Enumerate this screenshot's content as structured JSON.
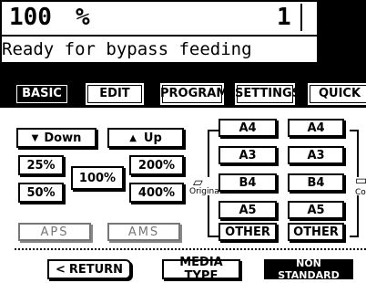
{
  "status": {
    "zoom_value": "100",
    "zoom_unit": "%",
    "copies": "1",
    "message": "Ready for bypass feeding"
  },
  "tabs": [
    {
      "label": "BASIC",
      "active": true
    },
    {
      "label": "EDIT"
    },
    {
      "label": "PROGRAM"
    },
    {
      "label": "SETTINGS"
    },
    {
      "label": "QUICK"
    }
  ],
  "zoom": {
    "down": "Down",
    "up": "Up",
    "p25": "25%",
    "p50": "50%",
    "p100": "100%",
    "p200": "200%",
    "p400": "400%",
    "aps": "APS",
    "ams": "AMS"
  },
  "original": {
    "label": "Original",
    "sizes": [
      "A4",
      "A3",
      "B4",
      "A5",
      "OTHER"
    ]
  },
  "copy": {
    "label": "Cop",
    "sizes": [
      "A4",
      "A3",
      "B4",
      "A5",
      "OTHER"
    ]
  },
  "bottom": {
    "return": "RETURN",
    "media_type": "MEDIA TYPE",
    "non_standard": "NON STANDARD"
  }
}
